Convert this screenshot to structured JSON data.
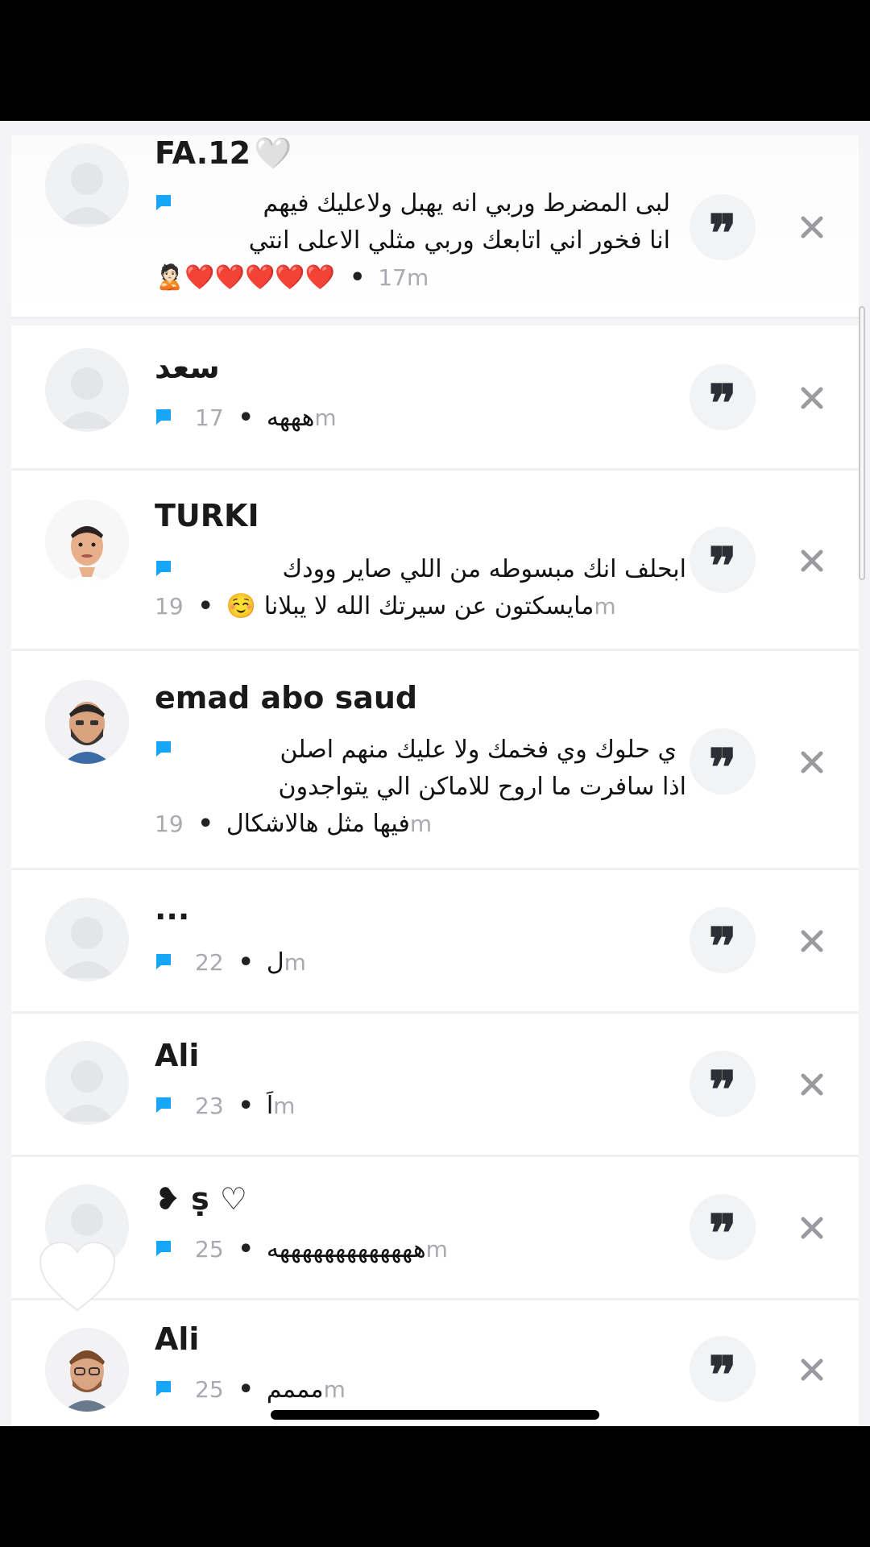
{
  "colors": {
    "accent": "#1da1f2",
    "chat_icon": "#16a6f5",
    "hearts": "#e0202a"
  },
  "icons": {
    "reply": "quote-icon",
    "dismiss": "close-icon",
    "chat": "chat-bubble-icon",
    "like": "heart-icon"
  },
  "replies": [
    {
      "name": "FA.12",
      "name_suffix": "🤍",
      "lines": [
        "لبى المضرط وربي انه يهبل ولاعليك فيهم",
        "انا فخور اني اتابعك وربي مثلي الاعلى انتي"
      ],
      "last_line": "🙎🏻❤️❤️❤️❤️❤️",
      "time": "17m"
    },
    {
      "name": "سعد",
      "lines": [],
      "last_line": "هههه",
      "time": "17m"
    },
    {
      "name": "TURKI",
      "lines": [
        "ابحلف انك مبسوطه من اللي صاير وودك"
      ],
      "last_line": "مايسكتون عن سيرتك الله لا يبلانا ☺️",
      "time": "19m"
    },
    {
      "name": "emad abo saud",
      "lines": [
        "ي حلوك وي فخمك ولا عليك منهم اصلن",
        "اذا سافرت ما اروح للاماكن الي يتواجدون"
      ],
      "last_line": "فيها مثل هالاشكال",
      "time": "19m"
    },
    {
      "name": "...",
      "lines": [],
      "last_line": "ل",
      "time": "22m"
    },
    {
      "name": "Ali",
      "lines": [],
      "last_line": "اَ",
      "time": "23m"
    },
    {
      "name": "❥ ṣ ♡",
      "lines": [],
      "last_line": "هههههههههههههه",
      "time": "25m"
    },
    {
      "name": "Ali",
      "lines": [],
      "last_line": "مممم",
      "time": "25m"
    }
  ]
}
